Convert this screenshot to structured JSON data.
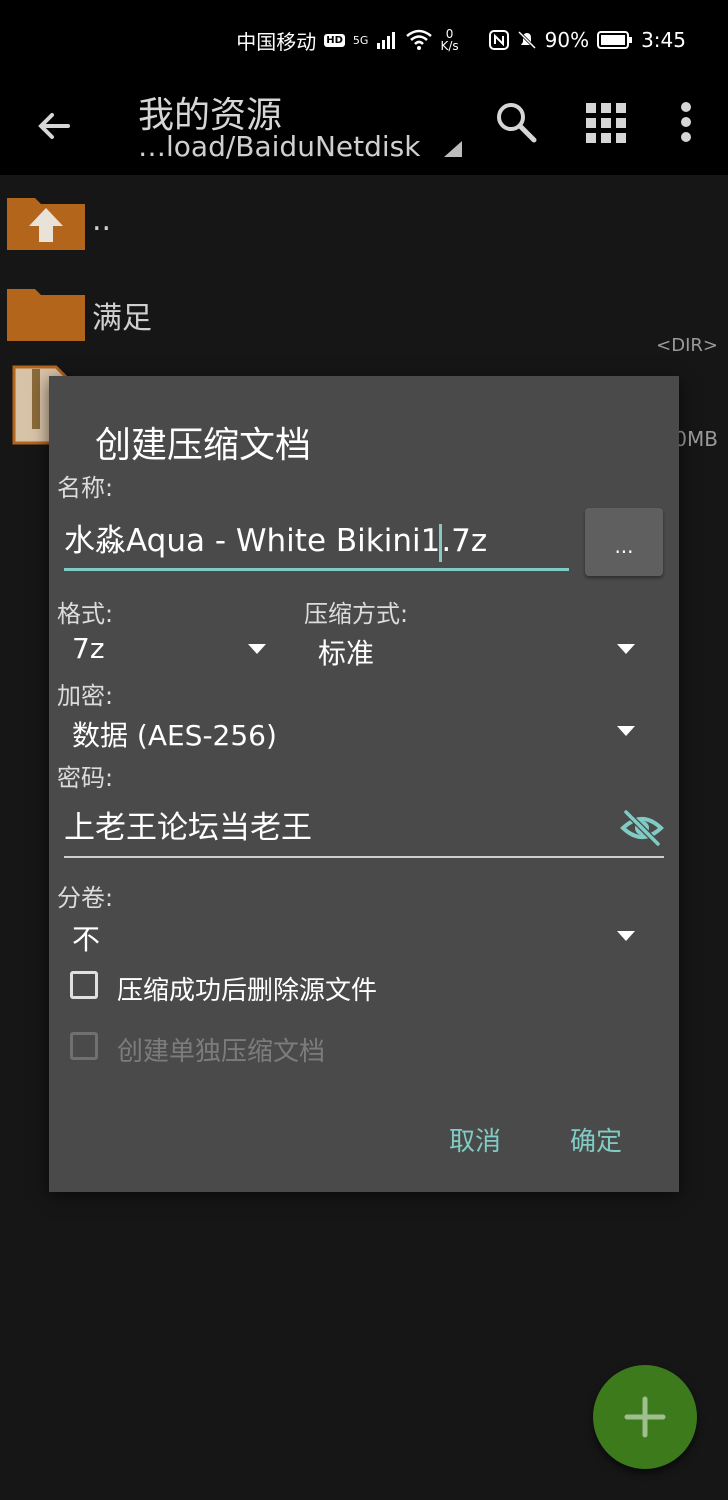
{
  "status_bar": {
    "carrier": "中国移动",
    "hd": "HD",
    "signal": "5G",
    "net_speed_value": "0",
    "net_speed_unit": "K/s",
    "battery": "90%",
    "time": "3:45"
  },
  "app_bar": {
    "title": "我的资源",
    "path": "…load/BaiduNetdisk"
  },
  "files": [
    {
      "name": "..",
      "tag": ""
    },
    {
      "name": "满足",
      "tag": "<DIR>"
    },
    {
      "name": "",
      "tag": "0MB"
    }
  ],
  "dialog": {
    "title": "创建压缩文档",
    "name_label": "名称:",
    "name_value_before_caret": "水淼Aqua - White Bikini1",
    "name_value_after_caret": ".7z",
    "browse_label": "...",
    "format_label": "格式:",
    "format_value": "7z",
    "method_label": "压缩方式:",
    "method_value": "标准",
    "encrypt_label": "加密:",
    "encrypt_value": "数据 (AES-256)",
    "password_label": "密码:",
    "password_value": "上老王论坛当老王",
    "split_label": "分卷:",
    "split_value": "不",
    "delete_source_label": "压缩成功后删除源文件",
    "delete_source_checked": false,
    "separate_archive_label": "创建单独压缩文档",
    "separate_archive_checked": false,
    "separate_archive_enabled": false,
    "cancel_label": "取消",
    "ok_label": "确定"
  },
  "colors": {
    "accent": "#80cbc4",
    "dialog_bg": "#4a4a4a",
    "fab": "#3d7a1c",
    "folder": "#b3651c"
  },
  "icons": {
    "back": "back-arrow-icon",
    "search": "search-icon",
    "grid": "grid-view-icon",
    "more": "more-vert-icon",
    "eye": "eye-off-icon",
    "fab": "add-icon"
  }
}
